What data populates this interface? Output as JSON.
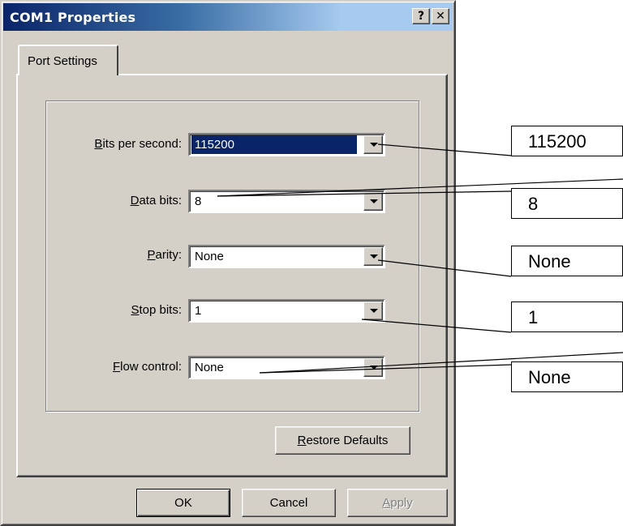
{
  "window": {
    "title": "COM1 Properties",
    "help_button": "?",
    "close_button": "✕"
  },
  "tabs": [
    {
      "label": "Port Settings",
      "active": true
    }
  ],
  "settings": {
    "bits_per_second": {
      "label_accel": "B",
      "label_rest": "its per second:",
      "value": "115200",
      "selected": true
    },
    "data_bits": {
      "label_accel": "D",
      "label_rest": "ata bits:",
      "value": "8"
    },
    "parity": {
      "label_accel": "P",
      "label_rest": "arity:",
      "value": "None"
    },
    "stop_bits": {
      "label_accel": "S",
      "label_rest": "top bits:",
      "value": "1"
    },
    "flow_control": {
      "label_accel": "F",
      "label_rest": "low control:",
      "value": "None"
    }
  },
  "buttons": {
    "restore_accel": "R",
    "restore_rest": "estore Defaults",
    "ok": "OK",
    "cancel": "Cancel",
    "apply_accel": "A",
    "apply_rest": "pply"
  },
  "callouts": [
    {
      "text": "115200"
    },
    {
      "text": "8"
    },
    {
      "text": "None"
    },
    {
      "text": "1"
    },
    {
      "text": "None"
    }
  ],
  "colors": {
    "titlebar_start": "#0a246a",
    "titlebar_end": "#a6caf0",
    "dialog_face": "#d4d0c8",
    "selection": "#0a246a"
  }
}
